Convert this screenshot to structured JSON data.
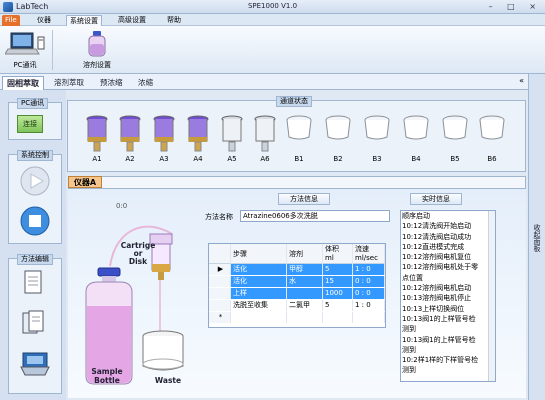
{
  "window": {
    "app_name": "LabTech",
    "title": "SPE1000 V1.0"
  },
  "menu": {
    "items": [
      "File",
      "仪器",
      "系统设置",
      "高级设置",
      "帮助"
    ]
  },
  "ribbon": {
    "buttons": [
      {
        "label": "PC通讯",
        "icon": "laptop-icon"
      },
      {
        "label": "溶剂设置",
        "icon": "solvent-bottle-icon"
      }
    ]
  },
  "subtabs": [
    "固相萃取",
    "溶剂萃取",
    "预浓缩",
    "浓缩"
  ],
  "right_panel": {
    "label": "收起面板"
  },
  "left_panel": {
    "pc_group": {
      "title": "PC通讯",
      "button": "连接"
    },
    "control_group": {
      "title": "系统控制",
      "play_icon": "play-icon",
      "stop_icon": "stop-icon"
    },
    "method_group": {
      "title": "方法编辑",
      "icons": [
        "new-document-icon",
        "documents-icon",
        "save-icon"
      ]
    }
  },
  "status": {
    "title": "通道状态",
    "vessels": [
      {
        "label": "A1",
        "kind": "cartridge",
        "filled": true
      },
      {
        "label": "A2",
        "kind": "cartridge",
        "filled": true
      },
      {
        "label": "A3",
        "kind": "cartridge",
        "filled": true
      },
      {
        "label": "A4",
        "kind": "cartridge",
        "filled": true
      },
      {
        "label": "A5",
        "kind": "cartridge",
        "filled": false
      },
      {
        "label": "A6",
        "kind": "cartridge",
        "filled": false
      },
      {
        "label": "B1",
        "kind": "cup",
        "filled": false
      },
      {
        "label": "B2",
        "kind": "cup",
        "filled": false
      },
      {
        "label": "B3",
        "kind": "cup",
        "filled": false
      },
      {
        "label": "B4",
        "kind": "cup",
        "filled": false
      },
      {
        "label": "B5",
        "kind": "cup",
        "filled": false
      },
      {
        "label": "B6",
        "kind": "cup",
        "filled": false
      }
    ]
  },
  "instrument": {
    "tab": "仪器A",
    "timer": "0:0",
    "diagram": {
      "cartridge_label": "Cartrige\nor\nDisk",
      "bottle_label": "Sample\nBottle",
      "waste_label": "Waste"
    },
    "method_info_btn": "方法信息",
    "realtime_btn": "实时信息",
    "method_name_label": "方法名称",
    "method_name_value": "Atrazine0606多次洗脱",
    "grid": {
      "headers": [
        "步骤",
        "溶剂",
        "体积\nml",
        "流速\nml/sec"
      ],
      "rows": [
        {
          "marker": "▶",
          "step": "活化",
          "solvent": "甲醇",
          "volume": "5",
          "flow": "1 : 0",
          "selected": true
        },
        {
          "marker": "",
          "step": "活化",
          "solvent": "水",
          "volume": "15",
          "flow": "0 : 0",
          "selected": true
        },
        {
          "marker": "",
          "step": "上样",
          "solvent": "",
          "volume": "1000",
          "flow": "0 : 0",
          "selected": true
        },
        {
          "marker": "",
          "step": "洗脱至收集",
          "solvent": "二氯甲",
          "volume": "5",
          "flow": "1 : 0",
          "selected": false
        },
        {
          "marker": "*",
          "step": "",
          "solvent": "",
          "volume": "",
          "flow": "",
          "selected": false
        }
      ]
    },
    "log": [
      "顺序启动",
      "10:12清洗阀开始启动",
      "10:12清洗阀启动成功",
      "10:12直进模式完成",
      "10:12溶剂阀电机复位",
      "10:12溶剂阀电机处于零",
      "点位置",
      "10:12溶剂阀电机启动",
      "10:13溶剂阀电机停止",
      "10:13上样切换阀位",
      "10:13阀1的上样管号检",
      "测到",
      "10:13阀1的上样管号检",
      "测到",
      "10:2样1样的下样管号检",
      "测到"
    ]
  }
}
